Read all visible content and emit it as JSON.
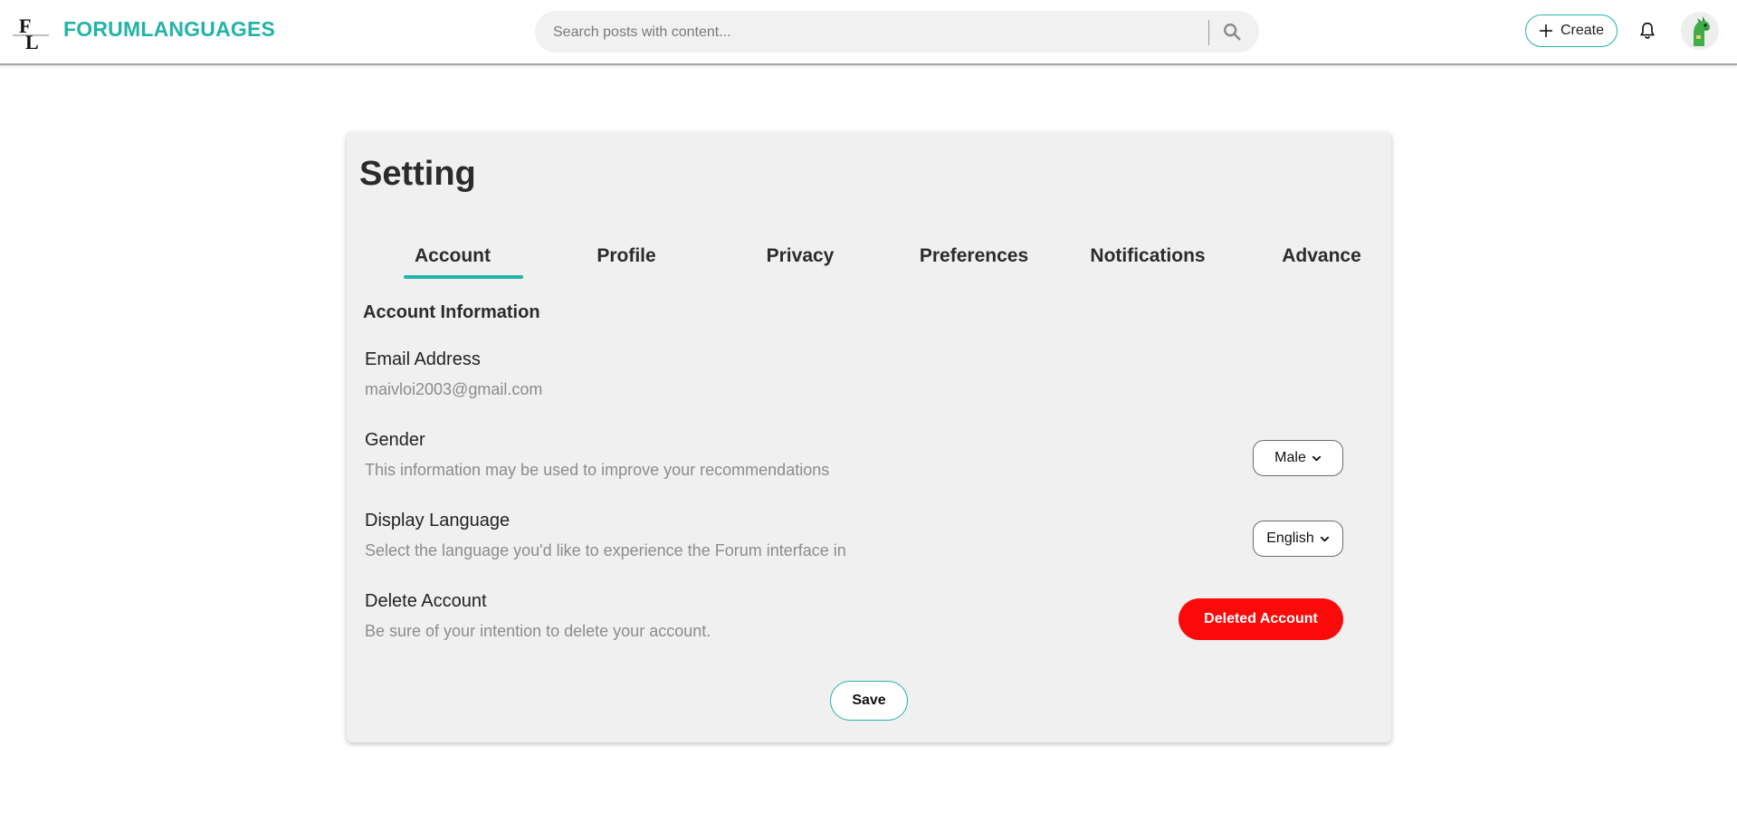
{
  "header": {
    "brand": "FORUMLANGUAGES",
    "search": {
      "placeholder": "Search posts with content..."
    },
    "create_label": "Create",
    "icons": [
      "logo-icon",
      "search-icon",
      "plus-icon",
      "bell-icon",
      "avatar"
    ]
  },
  "settings": {
    "title": "Setting",
    "tabs": [
      {
        "label": "Account",
        "active": true
      },
      {
        "label": "Profile",
        "active": false
      },
      {
        "label": "Privacy",
        "active": false
      },
      {
        "label": "Preferences",
        "active": false
      },
      {
        "label": "Notifications",
        "active": false
      },
      {
        "label": "Advance",
        "active": false
      }
    ],
    "section_title": "Account Information",
    "email": {
      "label": "Email Address",
      "value": "maivloi2003@gmail.com"
    },
    "gender": {
      "label": "Gender",
      "description": "This information may be used to improve your recommendations",
      "selected": "Male"
    },
    "display_language": {
      "label": "Display Language",
      "description": "Select the language you'd like to experience the Forum interface in",
      "selected": "English"
    },
    "delete_account": {
      "label": "Delete Account",
      "description": "Be sure of your intention to delete your account.",
      "button_label": "Deleted Account"
    },
    "save_label": "Save"
  },
  "colors": {
    "accent": "#23b3a9",
    "danger": "#fb0a0a",
    "card_background": "#f0f0f0"
  }
}
